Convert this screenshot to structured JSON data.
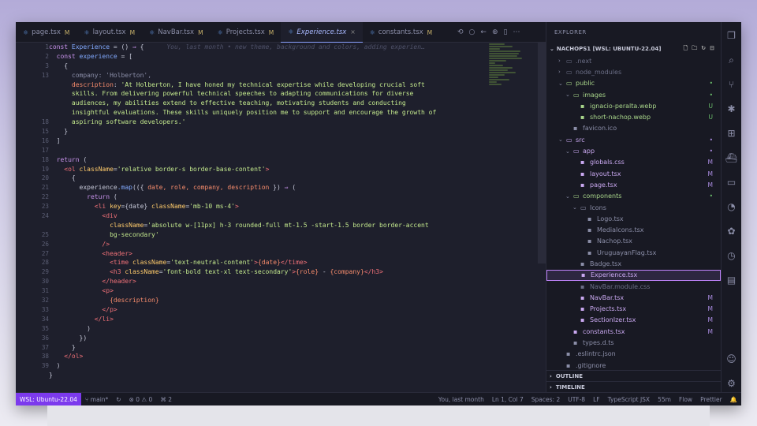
{
  "tabs": [
    {
      "label": "page.tsx",
      "status": "M"
    },
    {
      "label": "layout.tsx",
      "status": "M"
    },
    {
      "label": "NavBar.tsx",
      "status": "M"
    },
    {
      "label": "Projects.tsx",
      "status": "M"
    },
    {
      "label": "Experience.tsx",
      "status": "×",
      "active": true
    },
    {
      "label": "constants.tsx",
      "status": "M"
    }
  ],
  "editor": {
    "line_numbers": [
      "1",
      "2",
      "3",
      "13",
      "",
      "",
      "",
      "",
      "18",
      "15",
      "16",
      "17",
      "18",
      "19",
      "20",
      "21",
      "22",
      "23",
      "24",
      "",
      "25",
      "26",
      "27",
      "28",
      "29",
      "30",
      "31",
      "32",
      "33",
      "34",
      "35",
      "36",
      "37",
      "38",
      "39"
    ],
    "blame": "You, last month • new theme, background and colors, adding experien…",
    "lines": [
      [
        {
          "t": "const ",
          "c": "#c792ea"
        },
        {
          "t": "Experience",
          "c": "#82aaff"
        },
        {
          "t": " = () ",
          "c": "#c7c9d9"
        },
        {
          "t": "⇒",
          "c": "#c792ea"
        },
        {
          "t": " {",
          "c": "#c7c9d9"
        }
      ],
      [
        {
          "t": "  const ",
          "c": "#c792ea"
        },
        {
          "t": "experience",
          "c": "#82aaff"
        },
        {
          "t": " = [",
          "c": "#c7c9d9"
        }
      ],
      [
        {
          "t": "    {",
          "c": "#c7c9d9"
        }
      ],
      [
        {
          "t": "      company: 'Holberton',",
          "c": "#8b8ea8"
        }
      ],
      [
        {
          "t": "      description",
          "c": "#f78c6c"
        },
        {
          "t": ": ",
          "c": "#c7c9d9"
        },
        {
          "t": "'At Holberton, I have honed my technical expertise while developing crucial soft",
          "c": "#c3e88d"
        }
      ],
      [
        {
          "t": "      skills. From delivering powerful technical speeches to adapting communications for diverse",
          "c": "#c3e88d"
        }
      ],
      [
        {
          "t": "      audiences, my abilities extend to effective teaching, motivating students and conducting",
          "c": "#c3e88d"
        }
      ],
      [
        {
          "t": "      insightful evaluations. These skills uniquely position me to support and encourage the growth of",
          "c": "#c3e88d"
        }
      ],
      [
        {
          "t": "      aspiring software developers.'",
          "c": "#c3e88d"
        }
      ],
      [
        {
          "t": "    }",
          "c": "#c7c9d9"
        }
      ],
      [
        {
          "t": "  ]",
          "c": "#c7c9d9"
        }
      ],
      [
        {
          "t": "",
          "c": "#c7c9d9"
        }
      ],
      [
        {
          "t": "  return ",
          "c": "#c792ea"
        },
        {
          "t": "(",
          "c": "#c7c9d9"
        }
      ],
      [
        {
          "t": "    <ol ",
          "c": "#f07178"
        },
        {
          "t": "className",
          "c": "#ffcb6b"
        },
        {
          "t": "=",
          "c": "#c7c9d9"
        },
        {
          "t": "'relative border-s border-base-content'",
          "c": "#c3e88d"
        },
        {
          "t": ">",
          "c": "#f07178"
        }
      ],
      [
        {
          "t": "      {",
          "c": "#c7c9d9"
        }
      ],
      [
        {
          "t": "        experience",
          "c": "#c7c9d9"
        },
        {
          "t": ".map",
          "c": "#82aaff"
        },
        {
          "t": "(({ ",
          "c": "#c7c9d9"
        },
        {
          "t": "date, role, company, description",
          "c": "#f78c6c"
        },
        {
          "t": " }) ",
          "c": "#c7c9d9"
        },
        {
          "t": "⇒",
          "c": "#c792ea"
        },
        {
          "t": " (",
          "c": "#c7c9d9"
        }
      ],
      [
        {
          "t": "          return ",
          "c": "#c792ea"
        },
        {
          "t": "(",
          "c": "#c7c9d9"
        }
      ],
      [
        {
          "t": "            <li ",
          "c": "#f07178"
        },
        {
          "t": "key",
          "c": "#ffcb6b"
        },
        {
          "t": "={date} ",
          "c": "#c7c9d9"
        },
        {
          "t": "className",
          "c": "#ffcb6b"
        },
        {
          "t": "=",
          "c": "#c7c9d9"
        },
        {
          "t": "'mb-10 ms-4'",
          "c": "#c3e88d"
        },
        {
          "t": ">",
          "c": "#f07178"
        }
      ],
      [
        {
          "t": "              <div",
          "c": "#f07178"
        }
      ],
      [
        {
          "t": "                className",
          "c": "#ffcb6b"
        },
        {
          "t": "=",
          "c": "#c7c9d9"
        },
        {
          "t": "'absolute w-[11px] h-3 rounded-full mt-1.5 -start-1.5 border border-accent",
          "c": "#c3e88d"
        }
      ],
      [
        {
          "t": "                bg-secondary'",
          "c": "#c3e88d"
        }
      ],
      [
        {
          "t": "              />",
          "c": "#f07178"
        }
      ],
      [
        {
          "t": "              <header>",
          "c": "#f07178"
        }
      ],
      [
        {
          "t": "                <time ",
          "c": "#f07178"
        },
        {
          "t": "className",
          "c": "#ffcb6b"
        },
        {
          "t": "=",
          "c": "#c7c9d9"
        },
        {
          "t": "'text-neutral-content'",
          "c": "#c3e88d"
        },
        {
          "t": ">",
          "c": "#f07178"
        },
        {
          "t": "{date}",
          "c": "#f78c6c"
        },
        {
          "t": "</time>",
          "c": "#f07178"
        }
      ],
      [
        {
          "t": "                <h3 ",
          "c": "#f07178"
        },
        {
          "t": "className",
          "c": "#ffcb6b"
        },
        {
          "t": "=",
          "c": "#c7c9d9"
        },
        {
          "t": "'font-bold text-xl text-secondary'",
          "c": "#c3e88d"
        },
        {
          "t": ">",
          "c": "#f07178"
        },
        {
          "t": "{role}",
          "c": "#f78c6c"
        },
        {
          "t": " - ",
          "c": "#c7c9d9"
        },
        {
          "t": "{company}",
          "c": "#f78c6c"
        },
        {
          "t": "</h3>",
          "c": "#f07178"
        }
      ],
      [
        {
          "t": "              </header>",
          "c": "#f07178"
        }
      ],
      [
        {
          "t": "              <p>",
          "c": "#f07178"
        }
      ],
      [
        {
          "t": "                {description}",
          "c": "#f78c6c"
        }
      ],
      [
        {
          "t": "              </p>",
          "c": "#f07178"
        }
      ],
      [
        {
          "t": "            </li>",
          "c": "#f07178"
        }
      ],
      [
        {
          "t": "          )",
          "c": "#c7c9d9"
        }
      ],
      [
        {
          "t": "        })",
          "c": "#c7c9d9"
        }
      ],
      [
        {
          "t": "      }",
          "c": "#c7c9d9"
        }
      ],
      [
        {
          "t": "    </ol>",
          "c": "#f07178"
        }
      ],
      [
        {
          "t": "  )",
          "c": "#c7c9d9"
        }
      ],
      [
        {
          "t": "}",
          "c": "#c7c9d9"
        }
      ]
    ]
  },
  "explorer": {
    "header": "EXPLORER",
    "root": "NACHOPS1 [WSL: UBUNTU-22.04]",
    "items": [
      {
        "label": ".next",
        "depth": 1,
        "type": "folder",
        "chev": "›",
        "color": "#6b6e86",
        "badge": "",
        "bcolor": ""
      },
      {
        "label": "node_modules",
        "depth": 1,
        "type": "folder",
        "chev": "›",
        "color": "#6b6e86",
        "badge": "",
        "bcolor": ""
      },
      {
        "label": "public",
        "depth": 1,
        "type": "folder",
        "chev": "⌄",
        "color": "#a8d58a",
        "badge": "•",
        "bcolor": "#6cc16c"
      },
      {
        "label": "images",
        "depth": 2,
        "type": "folder",
        "chev": "⌄",
        "color": "#a8d58a",
        "badge": "•",
        "bcolor": "#6cc16c"
      },
      {
        "label": "ignacio-peralta.webp",
        "depth": 3,
        "type": "file",
        "chev": "",
        "color": "#a8d58a",
        "badge": "U",
        "bcolor": "#6cc16c"
      },
      {
        "label": "short-nachop.webp",
        "depth": 3,
        "type": "file",
        "chev": "",
        "color": "#a8d58a",
        "badge": "U",
        "bcolor": "#6cc16c"
      },
      {
        "label": "favicon.ico",
        "depth": 2,
        "type": "file",
        "chev": "",
        "color": "#8b8ea8",
        "badge": "",
        "bcolor": ""
      },
      {
        "label": "src",
        "depth": 1,
        "type": "folder",
        "chev": "⌄",
        "color": "#c9a8f0",
        "badge": "•",
        "bcolor": "#a98be0"
      },
      {
        "label": "app",
        "depth": 2,
        "type": "folder",
        "chev": "⌄",
        "color": "#c9a8f0",
        "badge": "•",
        "bcolor": "#a98be0"
      },
      {
        "label": "globals.css",
        "depth": 3,
        "type": "file",
        "chev": "",
        "color": "#c9a8f0",
        "badge": "M",
        "bcolor": "#a98be0"
      },
      {
        "label": "layout.tsx",
        "depth": 3,
        "type": "file",
        "chev": "",
        "color": "#c9a8f0",
        "badge": "M",
        "bcolor": "#a98be0"
      },
      {
        "label": "page.tsx",
        "depth": 3,
        "type": "file",
        "chev": "",
        "color": "#c9a8f0",
        "badge": "M",
        "bcolor": "#a98be0"
      },
      {
        "label": "components",
        "depth": 2,
        "type": "folder",
        "chev": "⌄",
        "color": "#a8d58a",
        "badge": "•",
        "bcolor": "#6cc16c"
      },
      {
        "label": "Icons",
        "depth": 3,
        "type": "folder",
        "chev": "⌄",
        "color": "#8b8ea8",
        "badge": "",
        "bcolor": ""
      },
      {
        "label": "Logo.tsx",
        "depth": 4,
        "type": "file",
        "chev": "",
        "color": "#8b8ea8",
        "badge": "",
        "bcolor": ""
      },
      {
        "label": "MediaIcons.tsx",
        "depth": 4,
        "type": "file",
        "chev": "",
        "color": "#8b8ea8",
        "badge": "",
        "bcolor": ""
      },
      {
        "label": "Nachop.tsx",
        "depth": 4,
        "type": "file",
        "chev": "",
        "color": "#8b8ea8",
        "badge": "",
        "bcolor": ""
      },
      {
        "label": "UruguayanFlag.tsx",
        "depth": 4,
        "type": "file",
        "chev": "",
        "color": "#8b8ea8",
        "badge": "",
        "bcolor": ""
      },
      {
        "label": "Badge.tsx",
        "depth": 3,
        "type": "file",
        "chev": "",
        "color": "#8b8ea8",
        "badge": "",
        "bcolor": ""
      },
      {
        "label": "Experience.tsx",
        "depth": 3,
        "type": "file",
        "chev": "",
        "color": "#c9a8f0",
        "badge": "",
        "bcolor": "",
        "selected": true
      },
      {
        "label": "NavBar.module.css",
        "depth": 3,
        "type": "file",
        "chev": "",
        "color": "#6b6e86",
        "badge": "",
        "bcolor": ""
      },
      {
        "label": "NavBar.tsx",
        "depth": 3,
        "type": "file",
        "chev": "",
        "color": "#c9a8f0",
        "badge": "M",
        "bcolor": "#a98be0"
      },
      {
        "label": "Projects.tsx",
        "depth": 3,
        "type": "file",
        "chev": "",
        "color": "#c9a8f0",
        "badge": "M",
        "bcolor": "#a98be0"
      },
      {
        "label": "SectionIzer.tsx",
        "depth": 3,
        "type": "file",
        "chev": "",
        "color": "#c9a8f0",
        "badge": "M",
        "bcolor": "#a98be0"
      },
      {
        "label": "constants.tsx",
        "depth": 2,
        "type": "file",
        "chev": "",
        "color": "#c9a8f0",
        "badge": "M",
        "bcolor": "#a98be0"
      },
      {
        "label": "types.d.ts",
        "depth": 2,
        "type": "file",
        "chev": "",
        "color": "#8b8ea8",
        "badge": "",
        "bcolor": ""
      },
      {
        "label": ".eslintrc.json",
        "depth": 1,
        "type": "file",
        "chev": "",
        "color": "#8b8ea8",
        "badge": "",
        "bcolor": ""
      },
      {
        "label": ".gitignore",
        "depth": 1,
        "type": "file",
        "chev": "",
        "color": "#8b8ea8",
        "badge": "",
        "bcolor": ""
      }
    ],
    "outline": "OUTLINE",
    "timeline": "TIMELINE"
  },
  "status": {
    "wsl": "WSL: Ubuntu-22.04",
    "branch": "main*",
    "problems": "⊗ 0 ⚠ 0",
    "ports": "⌘ 2",
    "blame": "You, last month",
    "position": "Ln 1, Col 7",
    "spaces": "Spaces: 2",
    "encoding": "UTF-8",
    "eol": "LF",
    "lang": "TypeScript JSX",
    "time": "55m",
    "flow": "Flow",
    "prettier": "Prettier"
  }
}
